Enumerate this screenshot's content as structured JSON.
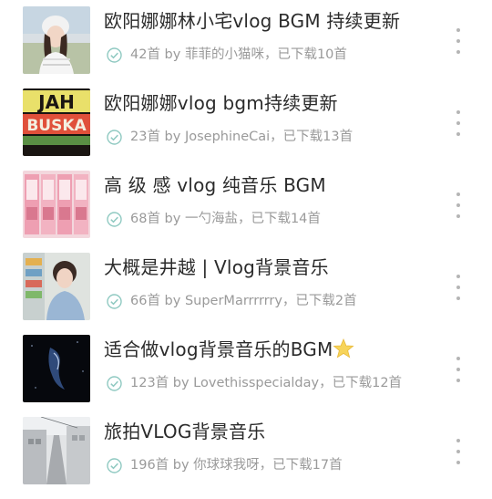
{
  "playlists": [
    {
      "title": "欧阳娜娜林小宅vlog BGM 持续更新",
      "subtitle": "42首 by 菲菲的小猫咪，已下载10首",
      "cover_icon": "girl-portrait-cover"
    },
    {
      "title": "欧阳娜娜vlog bgm持续更新",
      "subtitle": "23首 by JosephineCai，已下载13首",
      "cover_icon": "jah-buska-cover",
      "cover_text": [
        "JAH",
        "BUSKA"
      ]
    },
    {
      "title": "高 级 感 vlog 纯音乐 BGM",
      "subtitle": "68首 by 一勺海盐，已下载14首",
      "cover_icon": "pink-vending-machines-cover"
    },
    {
      "title": "大概是井越 | Vlog背景音乐",
      "subtitle": "66首 by SuperMarrrrrry，已下载2首",
      "cover_icon": "girl-at-vending-machine-cover"
    },
    {
      "title": "适合做vlog背景音乐的BGM",
      "subtitle": "123首 by Lovethisspecialday，已下载12首",
      "cover_icon": "night-silhouette-cover",
      "title_icon": "star-icon"
    },
    {
      "title": "旅拍VLOG背景音乐",
      "subtitle": "196首 by 你球球我呀，已下载17首",
      "cover_icon": "street-scene-cover"
    }
  ],
  "colors": {
    "check": "#8fc9c1",
    "title": "#2b2b2b",
    "subtitle": "#9a9a9a",
    "more_dots": "#b5b5b5",
    "star": "#f7d45a"
  }
}
